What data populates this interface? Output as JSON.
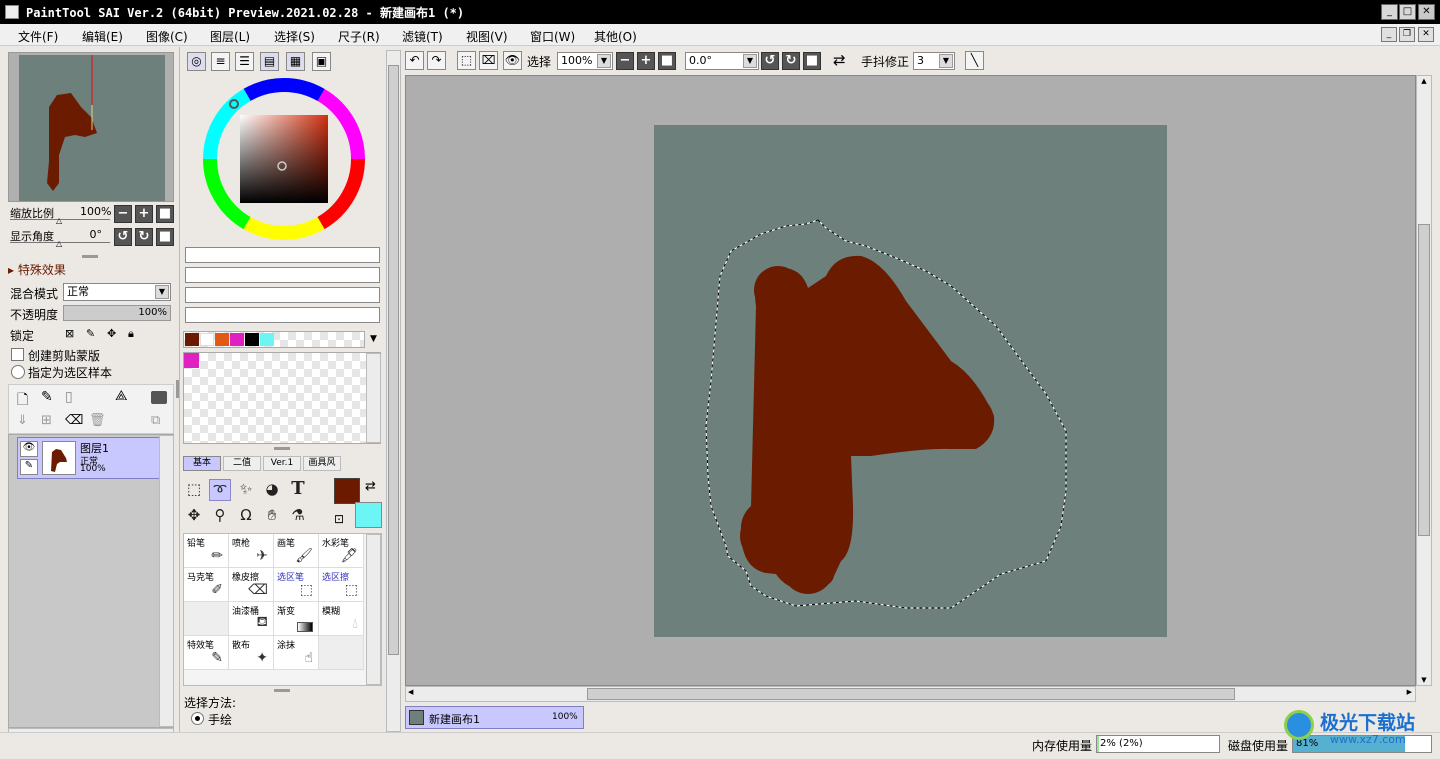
{
  "window": {
    "title": "PaintTool SAI Ver.2 (64bit) Preview.2021.02.28 - 新建画布1 (*)"
  },
  "menu": [
    "文件(F)",
    "编辑(E)",
    "图像(C)",
    "图层(L)",
    "选择(S)",
    "尺子(R)",
    "滤镜(T)",
    "视图(V)",
    "窗口(W)",
    "其他(O)"
  ],
  "navigator": {
    "zoom_label": "缩放比例",
    "zoom_value": "100%",
    "angle_label": "显示角度",
    "angle_value": "0°"
  },
  "layer_props": {
    "effects": "特殊效果",
    "blend_label": "混合模式",
    "blend_value": "正常",
    "opacity_label": "不透明度",
    "opacity_value": "100%",
    "lock_label": "锁定",
    "clip_label": "创建剪贴蒙版",
    "sel_sample_label": "指定为选区样本"
  },
  "layer": {
    "name": "图层1",
    "mode": "正常",
    "opacity": "100%"
  },
  "colors": {
    "primary": "#6b1a00",
    "secondary": "#6cf5f5",
    "canvas": "#6d807c",
    "paint": "#6b1c00",
    "swatches": [
      "#6b1a00",
      "#ffffff",
      "#e05a16",
      "#e020c0",
      "#000000",
      "#6cf5f5"
    ],
    "scratch": "#e020c0"
  },
  "tool_tabs": [
    "基本",
    "二值",
    "Ver.1",
    "画具风"
  ],
  "brushes": [
    [
      "铅笔",
      "喷枪",
      "画笔",
      "水彩笔"
    ],
    [
      "马克笔",
      "橡皮擦",
      "选区笔",
      "选区擦"
    ],
    [
      "",
      "油漆桶",
      "渐变",
      "模糊"
    ],
    [
      "特效笔",
      "散布",
      "涂抹",
      ""
    ]
  ],
  "select_method": {
    "label": "选择方法:",
    "option": "手绘"
  },
  "toolbar": {
    "select_label": "选择",
    "zoom": "100%",
    "angle": "0.0°",
    "stabilizer_label": "手抖修正",
    "stabilizer_value": "3"
  },
  "tab": {
    "name": "新建画布1",
    "zoom": "100%"
  },
  "status": {
    "mem_label": "内存使用量",
    "mem_value": "2% (2%)",
    "disk_label": "磁盘使用量",
    "disk_value": "81%"
  },
  "watermark": {
    "name": "极光下载站",
    "url": "www.xz7.com"
  }
}
